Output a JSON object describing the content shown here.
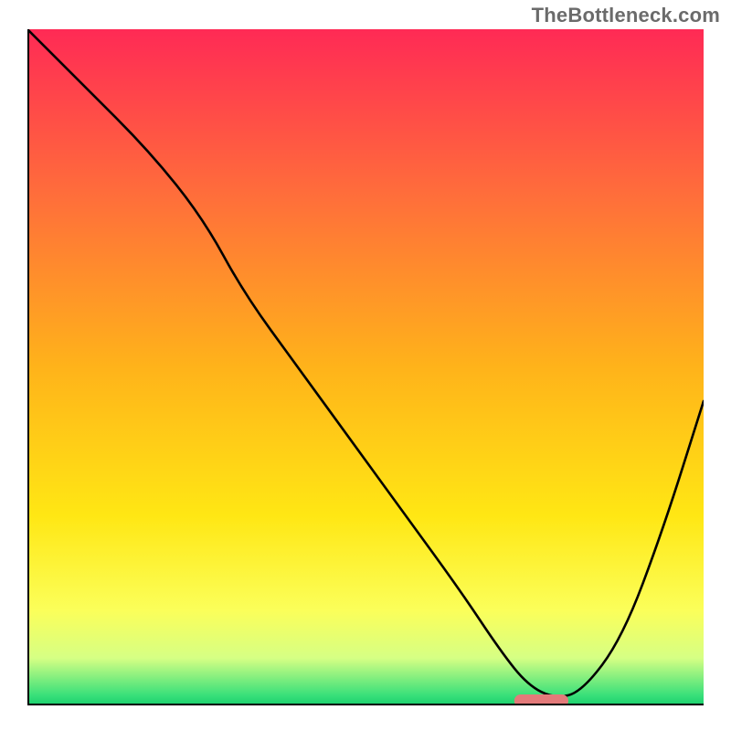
{
  "watermark": "TheBottleneck.com",
  "chart_data": {
    "type": "line",
    "title": "",
    "xlabel": "",
    "ylabel": "",
    "xlim": [
      0,
      100
    ],
    "ylim": [
      0,
      100
    ],
    "grid": false,
    "legend": false,
    "background_gradient": [
      {
        "pos": 0.0,
        "color": "#ff2a55"
      },
      {
        "pos": 0.25,
        "color": "#ff6f3a"
      },
      {
        "pos": 0.5,
        "color": "#ffb31a"
      },
      {
        "pos": 0.72,
        "color": "#ffe714"
      },
      {
        "pos": 0.86,
        "color": "#fbff5a"
      },
      {
        "pos": 0.93,
        "color": "#d6ff84"
      },
      {
        "pos": 0.985,
        "color": "#39e07a"
      },
      {
        "pos": 1.0,
        "color": "#19cf6d"
      }
    ],
    "series": [
      {
        "name": "bottleneck-curve",
        "color": "#000000",
        "stroke_width": 2.6,
        "x": [
          0,
          8,
          18,
          26,
          32,
          40,
          48,
          56,
          64,
          70,
          74,
          78,
          82,
          88,
          94,
          100
        ],
        "values": [
          100,
          92,
          82,
          72,
          61,
          50,
          39,
          28,
          17,
          8,
          3,
          1,
          2,
          10,
          26,
          45
        ]
      }
    ],
    "marker": {
      "name": "optimal-marker",
      "color": "#e37a7a",
      "x_start": 72,
      "x_end": 80,
      "y": 0,
      "height": 2
    }
  }
}
